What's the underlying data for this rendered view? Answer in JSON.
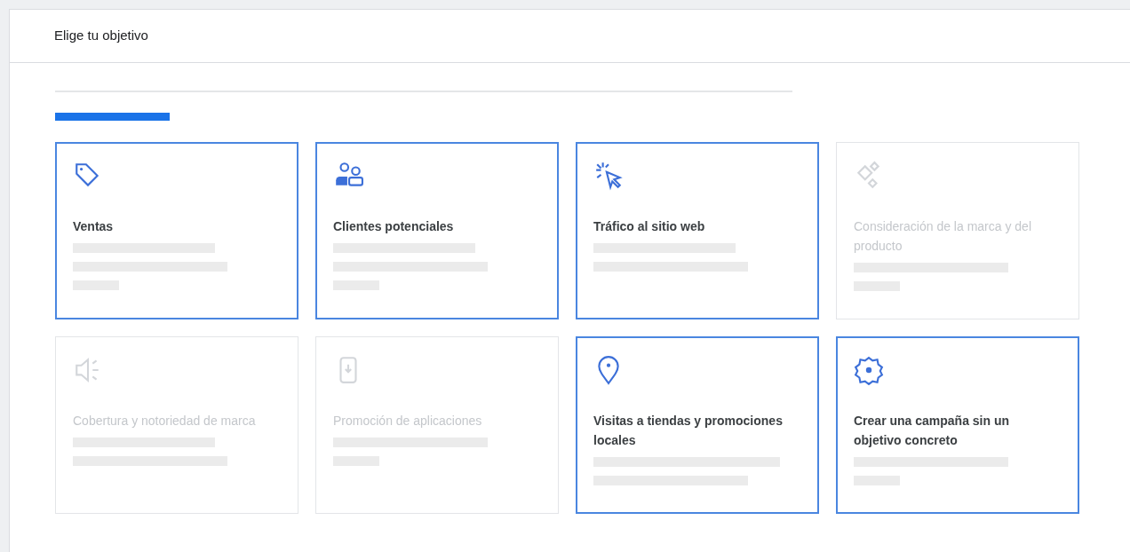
{
  "header": {
    "title": "Elige tu objetivo"
  },
  "progress": {
    "level": 0.155
  },
  "cards": [
    {
      "kind": "tag",
      "title": "Ventas",
      "disabled": false
    },
    {
      "kind": "people",
      "title": "Clientes potenciales",
      "disabled": false
    },
    {
      "kind": "cursor",
      "title": "Tráfico al sitio web",
      "disabled": false
    },
    {
      "kind": "sparkle",
      "title": "Consideración de la marca y del producto",
      "disabled": true
    },
    {
      "kind": "speaker",
      "title": "Cobertura y notoriedad de marca",
      "disabled": true
    },
    {
      "kind": "phone",
      "title": "Promoción de aplicaciones",
      "disabled": true
    },
    {
      "kind": "pin",
      "title": "Visitas a tiendas y promociones locales",
      "disabled": false
    },
    {
      "kind": "gear",
      "title": "Crear una campaña sin un objetivo concreto",
      "disabled": false
    }
  ]
}
